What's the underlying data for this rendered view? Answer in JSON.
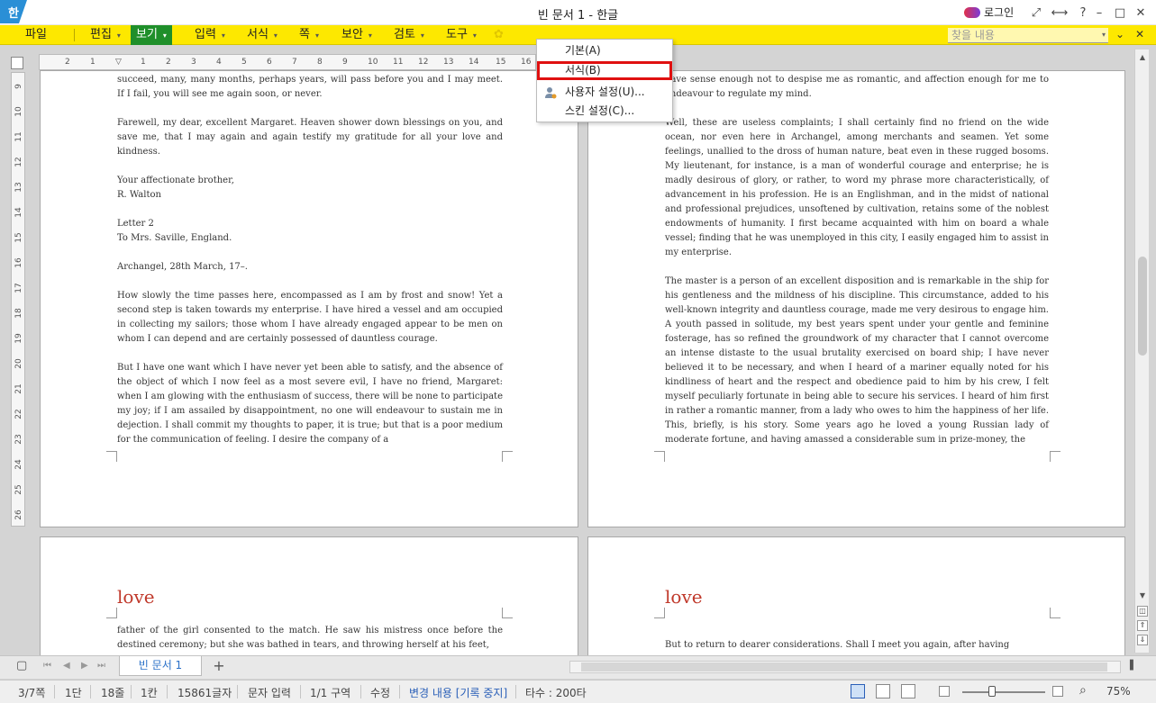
{
  "app": {
    "logo_text": "한",
    "title": "빈 문서 1 - 한글",
    "login_label": "로그인"
  },
  "window_controls": {
    "minimize": "–",
    "maximize": "□",
    "close": "✕",
    "help": "?"
  },
  "menu": {
    "items": [
      {
        "label": "파일",
        "caret": ""
      },
      {
        "label": "편집",
        "caret": "▾"
      },
      {
        "label": "보기",
        "caret": "▾"
      },
      {
        "label": "입력",
        "caret": "▾"
      },
      {
        "label": "서식",
        "caret": "▾"
      },
      {
        "label": "쪽",
        "caret": "▾"
      },
      {
        "label": "보안",
        "caret": "▾"
      },
      {
        "label": "검토",
        "caret": "▾"
      },
      {
        "label": "도구",
        "caret": "▾"
      }
    ],
    "search_placeholder": "찾을 내용"
  },
  "dropdown": {
    "items": [
      {
        "label": "기본(A)"
      },
      {
        "label": "서식(B)"
      },
      {
        "label": "사용자 설정(U)..."
      },
      {
        "label": "스킨 설정(C)..."
      }
    ]
  },
  "ruler": {
    "h_ticks": [
      "2",
      "1",
      "1",
      "2",
      "3",
      "4",
      "5",
      "6",
      "7",
      "8",
      "9",
      "10",
      "11",
      "12",
      "13",
      "14",
      "15",
      "16"
    ],
    "v_ticks": [
      "9",
      "10",
      "11",
      "12",
      "13",
      "14",
      "15",
      "16",
      "17",
      "18",
      "19",
      "20",
      "21",
      "22",
      "23",
      "24",
      "25",
      "26"
    ]
  },
  "pages": {
    "p1": {
      "paragraphs": [
        "succeed, many, many months, perhaps years, will pass before you and I may meet. If I fail, you will see me again soon, or never.",
        "Farewell, my dear, excellent Margaret. Heaven shower down blessings on you, and save me, that I may again and again testify my gratitude for all your love and kindness.",
        "Your affectionate brother,\nR. Walton",
        "Letter 2\nTo Mrs. Saville, England.",
        "Archangel, 28th March, 17–.",
        "How slowly the time passes here, encompassed as I am by frost and snow! Yet a second step is taken towards my enterprise. I have hired a vessel and am occupied in collecting my sailors; those whom I have already engaged appear to be men on whom I can depend and are certainly possessed of dauntless courage.",
        "But I have one want which I have never yet been able to satisfy, and the absence of the object of which I now feel as a most severe evil, I have no friend, Margaret: when I am glowing with the enthusiasm of success, there will be none to participate my joy; if I am assailed by disappointment, no one will endeavour to sustain me in dejection. I shall commit my thoughts to paper, it is true; but that is a poor medium for the communication of feeling. I desire the company of a"
      ]
    },
    "p2": {
      "paragraphs": [
        "have sense enough not to despise me as romantic, and affection enough for me to endeavour to regulate my mind.",
        "Well, these are useless complaints; I shall certainly find no friend on the wide ocean, nor even here in Archangel, among merchants and seamen. Yet some feelings, unallied to the dross of human nature, beat even in these rugged bosoms. My lieutenant, for instance, is a man of wonderful courage and enterprise; he is madly desirous of glory, or rather, to word my phrase more characteristically, of advancement in his profession. He is an Englishman, and in the midst of national and professional prejudices, unsoftened by cultivation, retains some of the noblest endowments of humanity. I first became acquainted with him on board a whale vessel; finding that he was unemployed in this city, I easily engaged him to assist in my enterprise.",
        "The master is a person of an excellent disposition and is remarkable in the ship for his gentleness and the mildness of his discipline. This circumstance, added to his well-known integrity and dauntless courage, made me very desirous to engage him. A youth passed in solitude, my best years spent under your gentle and feminine fosterage, has so refined the groundwork of my character that I cannot overcome an intense distaste to the usual brutality exercised on board ship; I have never believed it to be necessary, and when I heard of a mariner equally noted for his kindliness of heart and the respect and obedience paid to him by his crew, I felt myself peculiarly fortunate in being able to secure his services. I heard of him first in rather a romantic manner, from a lady who owes to him the happiness of her life. This, briefly, is his story. Some years ago he loved a young Russian lady of moderate fortune, and having amassed a considerable sum in prize-money, the"
      ]
    },
    "p3": {
      "heading": "love",
      "paragraphs": [
        "father of the girl consented to the match. He saw his mistress once before the destined ceremony; but she was bathed in tears, and throwing herself at his feet,"
      ]
    },
    "p4": {
      "heading": "love",
      "paragraphs": [
        "But to return to dearer considerations. Shall I meet you again, after having"
      ]
    }
  },
  "tabs": {
    "doc_tab": "빈 문서 1",
    "add": "+"
  },
  "status": {
    "page": "3/7쪽",
    "column": "1단",
    "line": "18줄",
    "col": "1칸",
    "chars": "15861글자",
    "mode": "문자 입력",
    "section": "1/1 구역",
    "edit": "수정",
    "track": "변경 내용 [기록 중지]",
    "typing": "타수 : 200타",
    "zoom": "75%"
  },
  "colors": {
    "menubar": "#fde800",
    "active_menu": "#1f8f2a",
    "highlight_box": "#e01010",
    "heading": "#c0392b"
  }
}
